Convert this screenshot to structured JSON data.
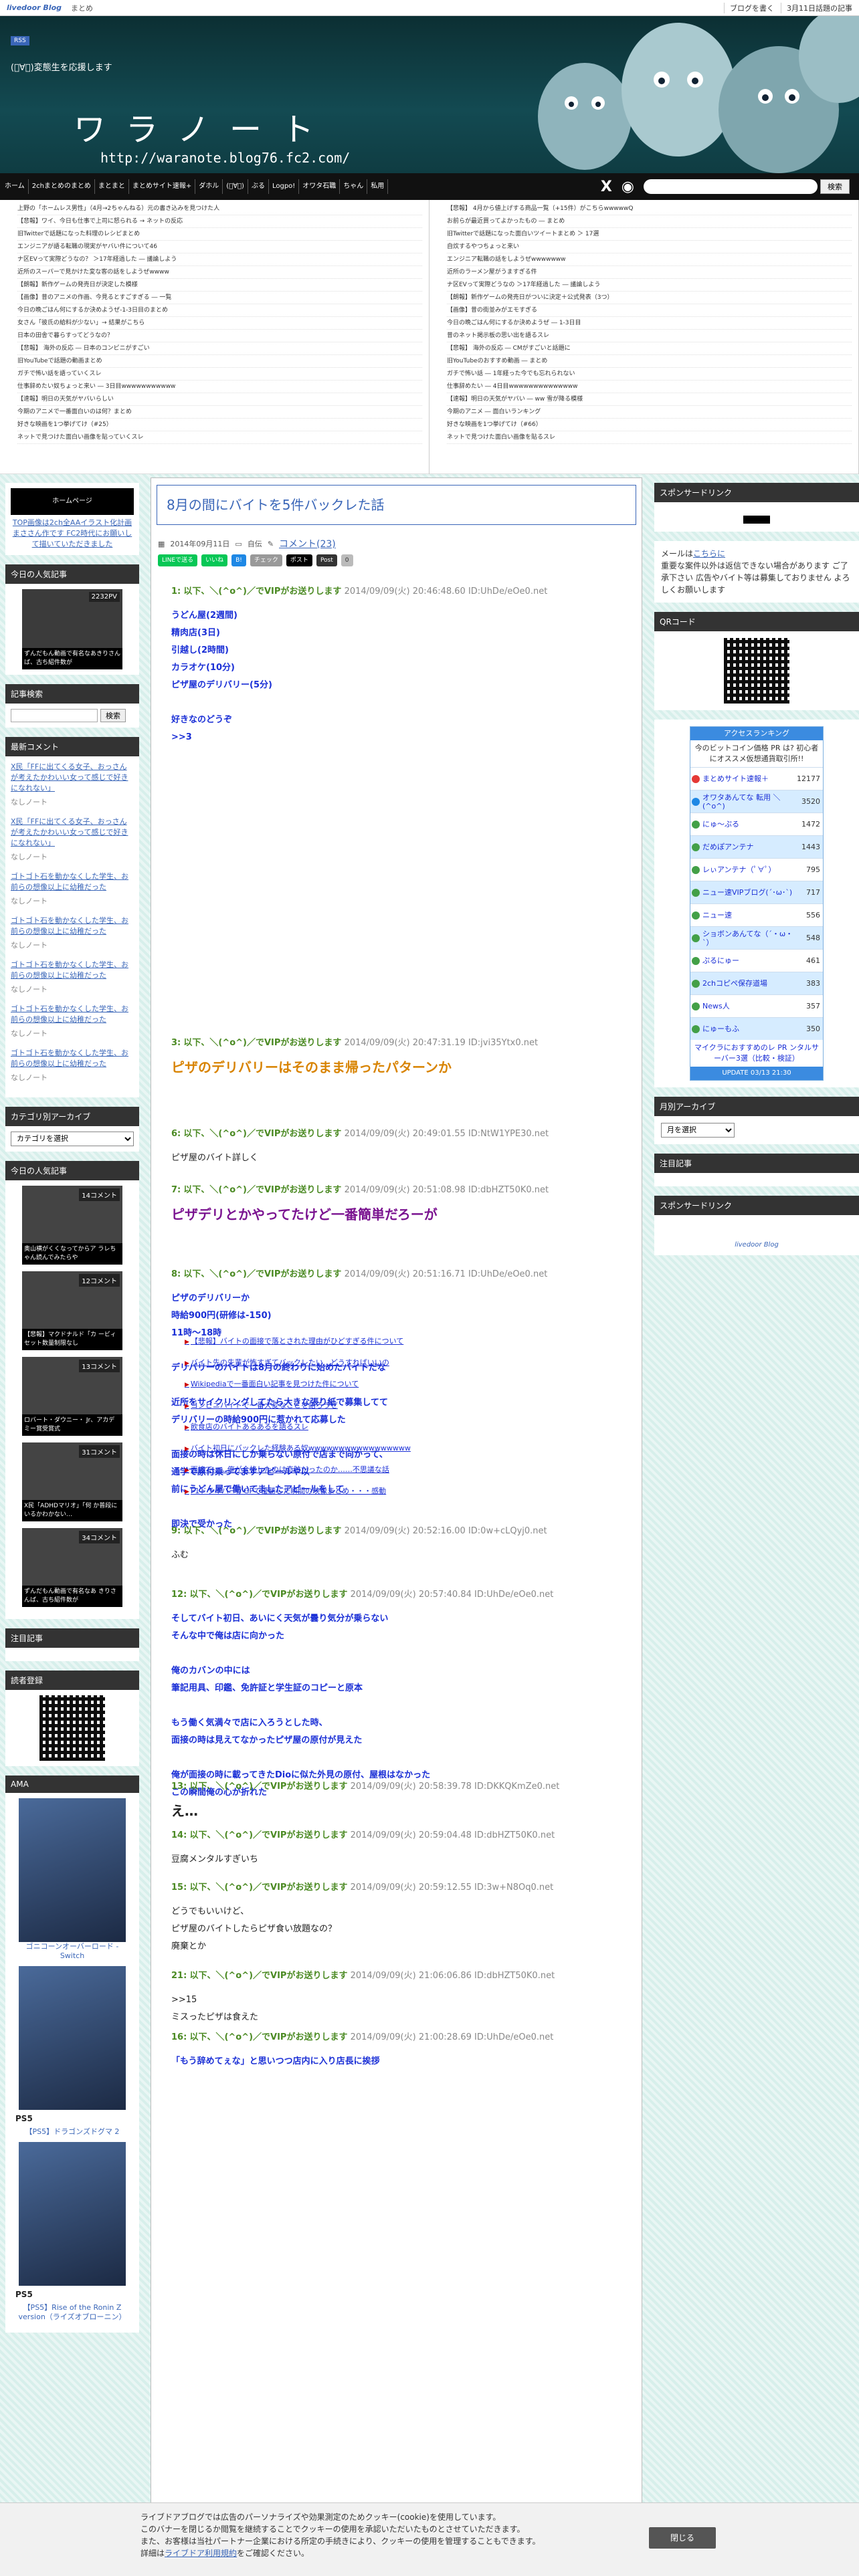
{
  "ldbar": {
    "logo": "livedoor Blog",
    "matome": "まとめ",
    "r1": "ブログを書く",
    "r2": "3月11日話題の記事"
  },
  "header": {
    "rss": "RSS",
    "tagline": "(ﾟ∀ﾟ)変態生を応援します",
    "title": "ワラノート",
    "url": "http://waranote.blog76.fc2.com/"
  },
  "nav": {
    "items": [
      "ホーム",
      "2chまとめのまとめ",
      "まとまと",
      "まとめサイト速報+",
      "ダホル",
      "(ﾟ∀ﾟ)",
      "ぶる",
      "Logpo!",
      "オワタ石職",
      "ちゃん",
      "私用"
    ],
    "social_x": "X",
    "search_button": "検索"
  },
  "rss_left": [
    "上野の「ホームレス男性」（4月→2ちゃんねる）元の書き込みを見つけた人",
    "【悲報】ワイ、今日も仕事で上司に怒られる → ネットの反応",
    "旧Twitterで話題になった料理のレシピまとめ",
    "エンジニアが語る転職の現実がヤバい件について46",
    "ナ区EVって実際どうなの？ ＞17年経過した ― 議論しよう",
    "近所のスーパーで見かけた変な客の話をしようぜwwww",
    "【朗報】新作ゲームの発売日が決定した模様",
    "【画像】昔のアニメの作画、今見るとすごすぎる ― 一覧",
    "今日の晩ごはん何にするか決めようぜ-1-3日目のまとめ",
    "女さん「彼氏の給料が少ない」→ 結果がこちら",
    "日本の田舎で暮らすってどうなの？",
    "【悲報】 海外の反応 ― 日本のコンビニがすごい",
    "旧YouTubeで話題の動画まとめ",
    "ガチで怖い話を語っていくスレ",
    "仕事辞めたい奴ちょっと来い ― 3日目wwwwwwwwwww",
    "【速報】明日の天気がヤバいらしい",
    "今期のアニメで一番面白いのは何？まとめ",
    "好きな映画を1つ挙げてけ（#25）",
    "ネットで見つけた面白い画像を貼っていくスレ"
  ],
  "rss_right": [
    "【悲報】 4月から値上げする商品一覧（+15件）がこちらwwwwwQ",
    "お前らが最近買ってよかったもの ― まとめ",
    "旧Twitterで話題になった面白いツイートまとめ ＞ 17選",
    "自炊するやつちょっと来い",
    "エンジニア転職の話をしようぜwwwwwww",
    "近所のラーメン屋がうますぎる件",
    "ナ区EVって実際どうなの ＞17年経過した ― 議論しよう",
    "【朗報】新作ゲームの発売日がついに決定＋公式発表（3つ）",
    "【画像】昔の街並みがエモすぎる",
    "今日の晩ごはん何にするか決めようぜ ― 1-3日目",
    "昔のネット掲示板の思い出を語るスレ",
    "【悲報】 海外の反応 ― CMがすごいと話題に",
    "旧YouTubeのおすすめ動画 ― まとめ",
    "ガチで怖い話 ― 1年経った今でも忘れられない",
    "仕事辞めたい ― 4日目wwwwwwwwwwwwww",
    "【速報】明日の天気がヤバい ― ww 雪が降る模様",
    "今期のアニメ ― 面白いランキング",
    "好きな映画を1つ挙げてけ（#66）",
    "ネットで見つけた面白い画像を貼るスレ"
  ],
  "left": {
    "hb_label": "ホームページ",
    "hb_link": "TOP画像は2ch全AAイラスト化計画 まささん作です FC2時代にお願いして描いていただきました",
    "pop_h": "今日の人気記事",
    "pop_cnt": "2232PV",
    "pop_cap": "ずんだもん動画で有名なあきりさんば、古ち紹件数が",
    "search_h": "記事検索",
    "search_btn": "検索",
    "cm_h": "最新コメント",
    "comments": [
      {
        "t": "X民「FFに出てくる女子、おっさんが考えたかわいい女って感じで好きになれない」",
        "n": "なしノート"
      },
      {
        "t": "X民「FFに出てくる女子、おっさんが考えたかわいい女って感じで好きになれない」",
        "n": "なしノート"
      },
      {
        "t": "ゴトゴト石を動かなくした学生、お前らの想像以上に幼稚だった",
        "n": "なしノート"
      },
      {
        "t": "ゴトゴト石を動かなくした学生、お前らの想像以上に幼稚だった",
        "n": "なしノート"
      },
      {
        "t": "ゴトゴト石を動かなくした学生、お前らの想像以上に幼稚だった",
        "n": "なしノート"
      },
      {
        "t": "ゴトゴト石を動かなくした学生、お前らの想像以上に幼稚だった",
        "n": "なしノート"
      },
      {
        "t": "ゴトゴト石を動かなくした学生、お前らの想像以上に幼稚だった",
        "n": "なしノート"
      }
    ],
    "cat_h": "カテゴリ別アーカイブ",
    "cat_sel": "カテゴリを選択",
    "today_h": "今日の人気記事",
    "today": [
      {
        "c": "14コメント",
        "cap": "奥山横がくくなってからア ラレちゃん読んでみたらや"
      },
      {
        "c": "12コメント",
        "cap": "【悲報】マクドナルド「カ ービィセット数量制限なし"
      },
      {
        "c": "13コメント",
        "cap": "ロバート・ダウニー・ Jr、アカデミー賞受賞式"
      },
      {
        "c": "31コメント",
        "cap": "X民「ADHDマリオ」「何 か普段にいるかわかない…"
      },
      {
        "c": "34コメント",
        "cap": "ずんだもん動画で有名なあ きりさんば、古ち紹件数が"
      }
    ],
    "att_h": "注目記事",
    "reader_h": "読者登録",
    "ama_h": "AMA",
    "products": [
      {
        "ps": "",
        "t": "ゴニコーンオーバーロード - Switch"
      },
      {
        "ps": "PS5",
        "t": "【PS5】ドラゴンズドグマ 2"
      },
      {
        "ps": "PS5",
        "t": "【PS5】Rise of the Ronin Z version（ライズオブローニン）"
      }
    ]
  },
  "article": {
    "title": "8月の間にバイトを5件バックレた話",
    "date": "2014年09月11日",
    "cat": "自伝",
    "comments": "コメント(23)",
    "share": [
      "LINEで送る",
      "いいね",
      "B!",
      "チェック",
      "ポスト",
      "Post",
      "0"
    ],
    "posts": [
      {
        "num": "1:",
        "nm": "以下、＼(^o^)／でVIPがお送りします",
        "meta": "2014/09/09(火) 20:46:48.60 ID:UhDe/eOe0.net",
        "lines": [
          "うどん屋(2週間)",
          "精肉店(3日)",
          "引越し(2時間)",
          "カラオケ(10分)",
          "ピザ屋のデリバリー(5分)",
          "",
          "好きなのどうぞ",
          ">>3"
        ],
        "cls": "blue"
      },
      {
        "num": "3:",
        "nm": "以下、＼(^o^)／でVIPがお送りします",
        "meta": "2014/09/09(火) 20:47:31.19 ID:jvi35Ytx0.net",
        "lines": [
          "ピザのデリバリーはそのまま帰ったパターンか"
        ],
        "cls": "orange"
      },
      {
        "num": "6:",
        "nm": "以下、＼(^o^)／でVIPがお送りします",
        "meta": "2014/09/09(火) 20:49:01.55 ID:NtW1YPE30.net",
        "lines": [
          "ピザ屋のバイト詳しく"
        ],
        "cls": ""
      },
      {
        "num": "7:",
        "nm": "以下、＼(^o^)／でVIPがお送りします",
        "meta": "2014/09/09(火) 20:51:08.98 ID:dbHZT50K0.net",
        "lines": [
          "ピザデリとかやってたけど一番簡単だろーが"
        ],
        "cls": "purple"
      },
      {
        "num": "8:",
        "nm": "以下、＼(^o^)／でVIPがお送りします",
        "meta": "2014/09/09(火) 20:51:16.71 ID:UhDe/eOe0.net",
        "lines": [
          "ピザのデリバリーか",
          "時給900円(研修は-150)",
          "11時～18時",
          "",
          "デリバリーのバイトは8月の終わりに始めたバイトだな",
          "",
          "近所をサイクリングしてたら大きな張り紙で募集してて",
          "デリバリーの時給900円に惹かれて応募した",
          "",
          "面接の時は休日にしか乗らない原付で店まで向かって、",
          "通学で原付乗ってますアピールや以",
          "前にうどん屋で働いてましたアピールをして",
          "",
          "即決で受かった"
        ],
        "cls": "blue"
      },
      {
        "num": "9:",
        "nm": "以下、＼(^o^)／でVIPがお送りします",
        "meta": "2014/09/09(火) 20:52:16.00 ID:0w+cLQyj0.net",
        "lines": [
          "ふむ"
        ],
        "cls": ""
      },
      {
        "num": "12:",
        "nm": "以下、＼(^o^)／でVIPがお送りします",
        "meta": "2014/09/09(火) 20:57:40.84 ID:UhDe/eOe0.net",
        "lines": [
          "そしてバイト初日、あいにく天気が曇り気分が乗らない",
          "そんな中で俺は店に向かった",
          "",
          "俺のカバンの中には",
          "筆記用具、印鑑、免許証と学生証のコピーと原本",
          "",
          "もう働く気満々で店に入ろうとした時、",
          "面接の時は見えてなかったピザ屋の原付が見えた",
          "",
          "俺が面接の時に載ってきたDioに似た外見の原付、屋根はなかった",
          "この瞬間俺の心が折れた"
        ],
        "cls": "blue"
      },
      {
        "num": "13:",
        "nm": "以下、＼(^o^)／でVIPがお送りします",
        "meta": "2014/09/09(火) 20:58:39.78 ID:DKKQKmZe0.net",
        "lines": [
          "え…"
        ],
        "cls": "big"
      },
      {
        "num": "14:",
        "nm": "以下、＼(^o^)／でVIPがお送りします",
        "meta": "2014/09/09(火) 20:59:04.48 ID:dbHZT50K0.net",
        "lines": [
          "豆腐メンタルすぎいち"
        ],
        "cls": ""
      },
      {
        "num": "15:",
        "nm": "以下、＼(^o^)／でVIPがお送りします",
        "meta": "2014/09/09(火) 20:59:12.55 ID:3w+N8Oq0.net",
        "lines": [
          "どうでもいいけど、",
          "ピザ屋のバイトしたらピザ食い放題なの？",
          "廃棄とか"
        ],
        "cls": ""
      },
      {
        "num": "21:",
        "nm": "以下、＼(^o^)／でVIPがお送りします",
        "meta": "2014/09/09(火) 21:06:06.86 ID:dbHZT50K0.net",
        "lines": [
          ">>15",
          "ミスったピザは食えた"
        ],
        "cls": ""
      },
      {
        "num": "16:",
        "nm": "以下、＼(^o^)／でVIPがお送りします",
        "meta": "2014/09/09(火) 21:00:28.69 ID:UhDe/eOe0.net",
        "lines": [
          "「もう辞めてぇな」と思いつつ店内に入り店長に挨拶"
        ],
        "cls": "blue"
      }
    ],
    "related": [
      "【悲報】バイトの面接で落とされた理由がひどすぎる件について",
      "バイト先の先輩が怖すぎてバックレたい…どうすればいいの",
      "Wikipediaで一番面白い記事を見つけた件について",
      "コンビニバイトで一番大変なことを語ろうぜ",
      "飲食店のバイトあるあるを語るスレ",
      "バイト初日にバックレた経験ある奴wwwwwwwwwwwwwwwww",
      "面接で……俺が合格したのは奇跡だったのか……不思議な話",
      "F1ドライバーがGPで優勝した瞬間の映像まとめ・・・感動"
    ]
  },
  "right": {
    "spon_h": "スポンサードリンク",
    "mail1": "メールは",
    "mail_link": "こちらに",
    "mail_rest": "重要な案件以外は返信できない場合があります ご了承下さい 広告やバイト等は募集しておりません よろしくお願いします",
    "qr_h": "QRコード",
    "rank_hd": "アクセスランキング",
    "rank_sub": "今のビットコイン価格 PR は? 初心者にオススメ仮想通貨取引所!!",
    "ranks": [
      {
        "n": "まとめサイト速報＋",
        "v": "12177"
      },
      {
        "n": "オワタあんてな 転用 ＼(^o^)",
        "v": "3520"
      },
      {
        "n": "にゅ～ぷる",
        "v": "1472"
      },
      {
        "n": "だめぽアンテナ",
        "v": "1443"
      },
      {
        "n": "レぃアンテナ（ﾟ∀ﾟ）",
        "v": "795"
      },
      {
        "n": "ニュー速VIPブログ(´･ω･`)",
        "v": "717"
      },
      {
        "n": "ニュー速",
        "v": "556"
      },
      {
        "n": "ショボンあんてな（´・ω・`）",
        "v": "548"
      },
      {
        "n": "ぷるにゅー",
        "v": "461"
      },
      {
        "n": "2chコピペ保存道場",
        "v": "383"
      },
      {
        "n": "News人",
        "v": "357"
      },
      {
        "n": "にゅーもふ",
        "v": "350"
      }
    ],
    "rank_ad": "マイクラにおすすめのレ PR ンタルサーバー3選（比較・検証）",
    "rank_ft": "UPDATE 03/13 21:30",
    "month_h": "月別アーカイブ",
    "month_sel": "月を選択",
    "att_h": "注目記事",
    "spon2_h": "スポンサードリンク",
    "ld_logo": "livedoor Blog"
  },
  "cookie": {
    "l1": "ライブドアブログでは広告のパーソナライズや効果測定のためクッキー(cookie)を使用しています。",
    "l2": "このバナーを閉じるか閲覧を継続することでクッキーの使用を承認いただいたものとさせていただきます。",
    "l3": "また、お客様は当社パートナー企業における所定の手続きにより、クッキーの使用を管理することもできます。",
    "l4a": "詳細は",
    "l4link": "ライブドア利用規約",
    "l4b": "をご確認ください。",
    "btn": "閉じる"
  }
}
